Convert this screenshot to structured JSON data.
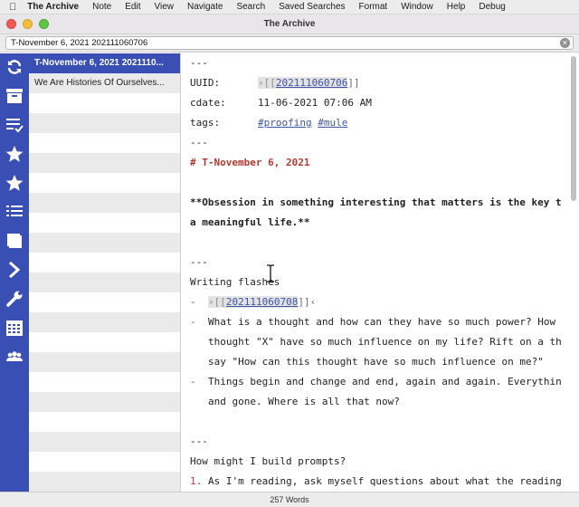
{
  "menubar": {
    "app": "The Archive",
    "items": [
      "Note",
      "Edit",
      "View",
      "Navigate",
      "Search",
      "Saved Searches",
      "Format",
      "Window",
      "Help",
      "Debug"
    ]
  },
  "window": {
    "title": "The Archive"
  },
  "omnibar": {
    "value": "T-November 6, 2021 202111060706"
  },
  "sidebar": {
    "icons": [
      "sync-icon",
      "archive-box-icon",
      "checklist-icon",
      "star-icon",
      "star-icon",
      "list-icon",
      "book-icon",
      "chevron-right-icon",
      "wrench-icon",
      "calendar-icon",
      "people-icon"
    ]
  },
  "note_list": {
    "items": [
      {
        "title": "T-November 6, 2021 2021110...",
        "selected": true
      },
      {
        "title": "We Are Histories Of Ourselves...",
        "selected": false
      }
    ]
  },
  "editor": {
    "hr1": "---",
    "uuid_key": "UUID:",
    "uuid_prefix": "›[[",
    "uuid_link": "202111060706",
    "uuid_suffix": "]]",
    "cdate_key": "cdate:",
    "cdate_value": "11-06-2021 07:06 AM",
    "tags_key": "tags:",
    "tag1": "#proofing",
    "tag2": "#mule",
    "hr2": "---",
    "heading": "# T-November 6, 2021",
    "bold_line1": "**Obsession in something interesting that matters is the key t",
    "bold_line2": "a meaningful life.**",
    "hr3": "---",
    "section1": "Writing flashes",
    "bullet_marker": "-",
    "b1_prefix": "›[[",
    "b1_link": "202111060708",
    "b1_suffix": "]]‹",
    "b2_line1": "What is a thought and how can they have so much power? How",
    "b2_line2": "thought \"X\" have so much influence on my life? Rift on a th",
    "b2_line3": "say \"How can this thought have so much influence on me?\"",
    "b3_line1": "Things begin and change and end, again and again. Everythin",
    "b3_line2": "and gone. Where is all that now?",
    "hr4": "---",
    "section2": "How might I build prompts?",
    "num_marker": "1.",
    "n1_line1": "As I'm reading, ask myself questions about what the reading"
  },
  "status": {
    "words": "257 Words"
  },
  "colors": {
    "accent": "#3a4fb3",
    "heading": "#b33a2e",
    "link": "#4055a6"
  }
}
